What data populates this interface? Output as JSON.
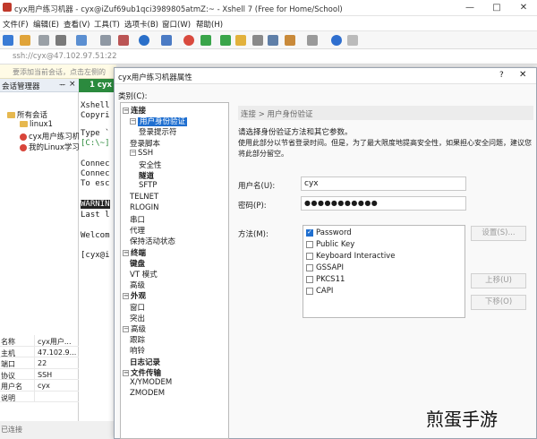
{
  "app": {
    "title": "cyx用户练习机器 - cyx@iZuf69ub1qci3989805atmZ:~ - Xshell 7 (Free for Home/School)",
    "window_controls": [
      "—",
      "□",
      "✕"
    ]
  },
  "menu": [
    "文件(F)",
    "编辑(E)",
    "查看(V)",
    "工具(T)",
    "选项卡(B)",
    "窗口(W)",
    "帮助(H)"
  ],
  "address": "ssh://cyx@47.102.97.51:22",
  "hint": "要添加当前会话，点击左侧的",
  "session_manager": {
    "title": "会话管理器",
    "pin": "ᅲ",
    "close": "×",
    "tree": [
      {
        "label": "所有会话"
      },
      {
        "label": "linux1"
      },
      {
        "label": "cyx用户练习机"
      },
      {
        "label": "我的Linux学习"
      }
    ],
    "properties": [
      {
        "k": "名称",
        "v": "cyx用户..."
      },
      {
        "k": "主机",
        "v": "47.102.9..."
      },
      {
        "k": "端口",
        "v": "22"
      },
      {
        "k": "协议",
        "v": "SSH"
      },
      {
        "k": "用户名",
        "v": "cyx"
      },
      {
        "k": "说明",
        "v": ""
      }
    ],
    "status": "已连接"
  },
  "tab": {
    "label": "1 cyx"
  },
  "terminal_lines": [
    "Xshell",
    "Copyri",
    "",
    "Type `",
    "[C:\\~]",
    "",
    "Connec",
    "Connec",
    "To esc",
    "",
    "WARNIN",
    "Last l",
    "",
    "Welcom",
    "",
    "[cyx@i"
  ],
  "dialog": {
    "title": "cyx用户练习机器属性",
    "help": "?",
    "close": "✕",
    "category_label": "类别(C):",
    "tree": [
      {
        "label": "连接",
        "bold": true,
        "box": "−",
        "level": 0
      },
      {
        "label": "用户身份验证",
        "selected": true,
        "box": "−",
        "level": 1
      },
      {
        "label": "登录提示符",
        "level": 2
      },
      {
        "label": "登录脚本",
        "level": 1
      },
      {
        "label": "SSH",
        "box": "−",
        "level": 1
      },
      {
        "label": "安全性",
        "level": 2
      },
      {
        "label": "隧道",
        "bold": true,
        "level": 2
      },
      {
        "label": "SFTP",
        "level": 2
      },
      {
        "label": "TELNET",
        "level": 1
      },
      {
        "label": "RLOGIN",
        "level": 1
      },
      {
        "label": "串口",
        "level": 1
      },
      {
        "label": "代理",
        "level": 1
      },
      {
        "label": "保持活动状态",
        "level": 1
      },
      {
        "label": "终端",
        "bold": true,
        "box": "−",
        "level": 0
      },
      {
        "label": "键盘",
        "bold": true,
        "level": 1
      },
      {
        "label": "VT 模式",
        "level": 1
      },
      {
        "label": "高级",
        "level": 1
      },
      {
        "label": "外观",
        "bold": true,
        "box": "−",
        "level": 0
      },
      {
        "label": "窗口",
        "level": 1
      },
      {
        "label": "突出",
        "level": 1
      },
      {
        "label": "高级",
        "box": "−",
        "level": 0
      },
      {
        "label": "跟踪",
        "level": 1
      },
      {
        "label": "响铃",
        "level": 1
      },
      {
        "label": "日志记录",
        "bold": true,
        "level": 1
      },
      {
        "label": "文件传输",
        "bold": true,
        "box": "−",
        "level": 0
      },
      {
        "label": "X/YMODEM",
        "level": 1
      },
      {
        "label": "ZMODEM",
        "level": 1
      }
    ],
    "breadcrumb": "连接 > 用户身份验证",
    "desc1": "请选择身份验证方法和其它参数。",
    "desc2": "使用此部分以节省登录时间。但是，为了最大限度地提高安全性，如果担心安全问题，建议您将此部分留空。",
    "username_label": "用户名(U):",
    "username": "cyx",
    "password_label": "密码(P):",
    "password": "●●●●●●●●●●●",
    "method_label": "方法(M):",
    "methods": [
      {
        "label": "Password",
        "checked": true
      },
      {
        "label": "Public Key",
        "checked": false
      },
      {
        "label": "Keyboard Interactive",
        "checked": false
      },
      {
        "label": "GSSAPI",
        "checked": false
      },
      {
        "label": "PKCS11",
        "checked": false
      },
      {
        "label": "CAPI",
        "checked": false
      }
    ],
    "buttons": {
      "settings": "设置(S)...",
      "up": "上移(U)",
      "down": "下移(O)"
    }
  },
  "watermark": "煎蛋手游"
}
